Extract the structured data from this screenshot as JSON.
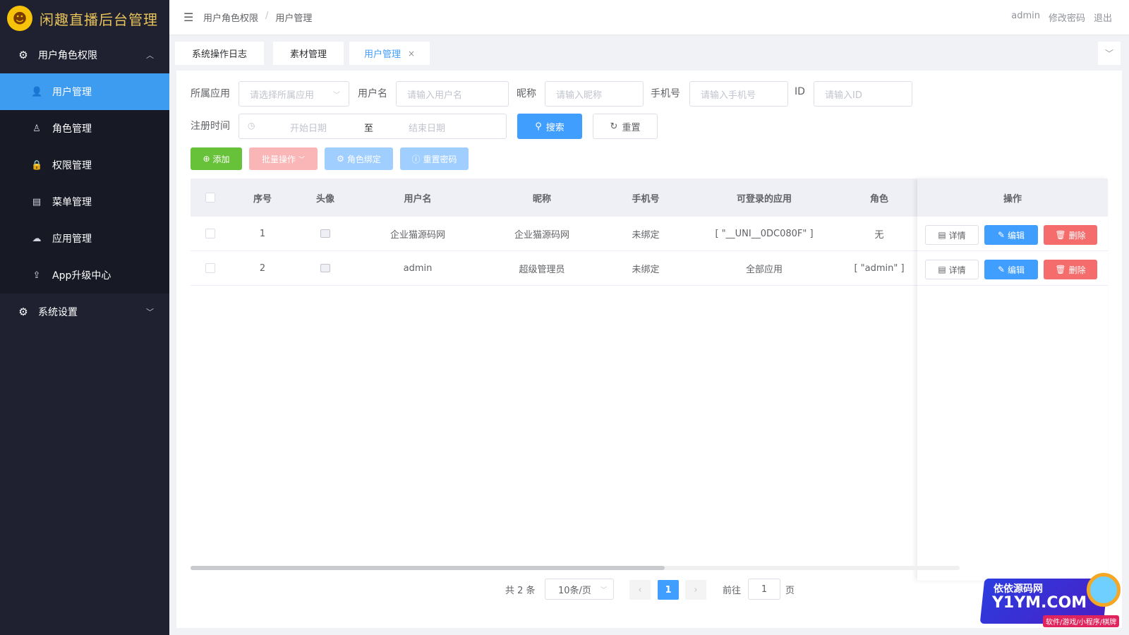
{
  "app": {
    "title": "闲趣直播后台管理",
    "logo_glyph": "☻"
  },
  "sidebar": {
    "group1": {
      "label": "用户角色权限",
      "icon": "gear-icon"
    },
    "items": [
      {
        "label": "用户管理",
        "icon": "user-icon",
        "glyph": "👤",
        "active": true
      },
      {
        "label": "角色管理",
        "icon": "user-outline-icon",
        "glyph": "♙",
        "active": false
      },
      {
        "label": "权限管理",
        "icon": "lock-icon",
        "glyph": "🔒",
        "active": false
      },
      {
        "label": "菜单管理",
        "icon": "document-icon",
        "glyph": "▤",
        "active": false
      },
      {
        "label": "应用管理",
        "icon": "cloud-icon",
        "glyph": "☁",
        "active": false
      },
      {
        "label": "App升级中心",
        "icon": "cloud-upload-icon",
        "glyph": "⇪",
        "active": false
      }
    ],
    "group2": {
      "label": "系统设置",
      "icon": "gear-icon"
    }
  },
  "header": {
    "breadcrumb": [
      "用户角色权限",
      "用户管理"
    ],
    "separator": "/",
    "user": "admin",
    "change_password": "修改密码",
    "logout": "退出"
  },
  "tags": [
    {
      "label": "系统操作日志"
    },
    {
      "label": "素材管理"
    },
    {
      "label": "用户管理",
      "close": "×"
    }
  ],
  "filters": {
    "app_label": "所属应用",
    "app_placeholder": "请选择所属应用",
    "username_label": "用户名",
    "username_placeholder": "请输入用户名",
    "nickname_label": "昵称",
    "nickname_placeholder": "请输入昵称",
    "phone_label": "手机号",
    "phone_placeholder": "请输入手机号",
    "id_label": "ID",
    "id_placeholder": "请输入ID",
    "regtime_label": "注册时间",
    "start_placeholder": "开始日期",
    "range_sep": "至",
    "end_placeholder": "结束日期",
    "search": "搜索",
    "reset": "重置"
  },
  "toolbar": {
    "add": "添加",
    "batch": "批量操作",
    "bind_role": "角色绑定",
    "reset_password": "重置密码"
  },
  "table": {
    "columns": {
      "index": "序号",
      "avatar": "头像",
      "username": "用户名",
      "nickname": "昵称",
      "phone": "手机号",
      "apps": "可登录的应用",
      "role": "角色",
      "ops": "操作"
    },
    "rows": [
      {
        "index": "1",
        "username": "企业猫源码网",
        "nickname": "企业猫源码网",
        "phone": "未绑定",
        "apps": "[ \"__UNI__0DC080F\" ]",
        "role": "无"
      },
      {
        "index": "2",
        "username": "admin",
        "nickname": "超级管理员",
        "phone": "未绑定",
        "apps": "全部应用",
        "role": "[ \"admin\" ]"
      }
    ],
    "op_detail": "详情",
    "op_edit": "编辑",
    "op_delete": "删除"
  },
  "pagination": {
    "total": "共 2 条",
    "page_size": "10条/页",
    "current": "1",
    "goto_prefix": "前往",
    "goto_value": "1",
    "goto_suffix": "页"
  },
  "watermark": {
    "line1": "依依源码网",
    "line2": "Y1YM.COM",
    "line3": "软件/游戏/小程序/棋牌"
  },
  "colors": {
    "sidebar_bg": "#1f2130",
    "active_blue": "#3d9bf0",
    "primary": "#409eff",
    "success": "#67c23a",
    "danger": "#f56c6c"
  }
}
